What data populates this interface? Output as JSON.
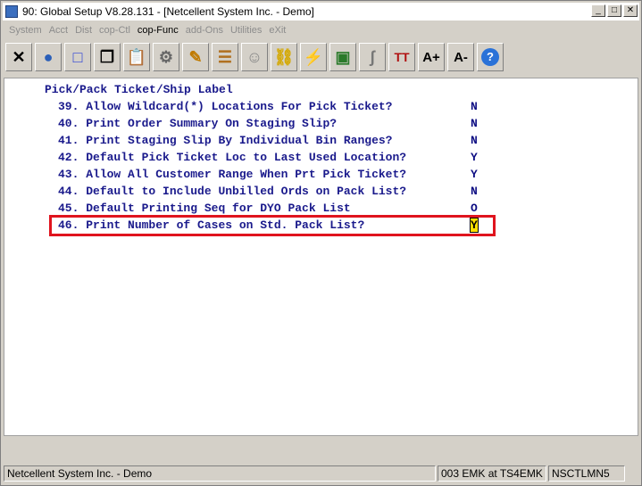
{
  "window": {
    "title": "90: Global Setup V8.28.131 - [Netcellent System Inc. - Demo]"
  },
  "menu": [
    "System",
    "Acct",
    "Dist",
    "cop-Ctl",
    "cop-Func",
    "add-Ons",
    "Utilities",
    "eXit"
  ],
  "toolbar": [
    {
      "name": "close-tool-icon",
      "glyph": "✕"
    },
    {
      "name": "globe-icon",
      "glyph": "●"
    },
    {
      "name": "select-box-icon",
      "glyph": "□"
    },
    {
      "name": "copy-icon",
      "glyph": "❐"
    },
    {
      "name": "paste-icon",
      "glyph": "📋"
    },
    {
      "name": "settings-icon",
      "glyph": "⚙"
    },
    {
      "name": "edit-icon",
      "glyph": "✎"
    },
    {
      "name": "notes-icon",
      "glyph": "☰"
    },
    {
      "name": "users-icon",
      "glyph": "☺"
    },
    {
      "name": "link-icon",
      "glyph": "⛓"
    },
    {
      "name": "lightning-icon",
      "glyph": "⚡"
    },
    {
      "name": "window-flash-icon",
      "glyph": "▣"
    },
    {
      "name": "signature-icon",
      "glyph": "ʃ"
    },
    {
      "name": "font-type-icon",
      "glyph": "TT"
    },
    {
      "name": "increase-font-icon",
      "glyph": "A+"
    },
    {
      "name": "decrease-font-icon",
      "glyph": "A-"
    },
    {
      "name": "help-icon",
      "glyph": "?"
    }
  ],
  "screen": {
    "header": "Pick/Pack Ticket/Ship Label",
    "rows": [
      {
        "num": "39.",
        "label": "Allow Wildcard(*) Locations For Pick Ticket?",
        "value": "N"
      },
      {
        "num": "40.",
        "label": "Print Order Summary On Staging Slip?",
        "value": "N"
      },
      {
        "num": "41.",
        "label": "Print Staging Slip By Individual Bin Ranges?",
        "value": "N"
      },
      {
        "num": "42.",
        "label": "Default Pick Ticket Loc to Last Used Location?",
        "value": "Y"
      },
      {
        "num": "43.",
        "label": "Allow All Customer Range When Prt Pick Ticket?",
        "value": "Y"
      },
      {
        "num": "44.",
        "label": "Default to Include Unbilled Ords on Pack List?",
        "value": "N"
      },
      {
        "num": "45.",
        "label": "Default Printing Seq for DYO Pack List",
        "value": "O"
      },
      {
        "num": "46.",
        "label": "Print Number of Cases on Std. Pack List?",
        "value": "Y"
      }
    ]
  },
  "status": {
    "company": "Netcellent System Inc. - Demo",
    "user": "003 EMK at TS4EMK",
    "server": "NSCTLMN5"
  },
  "colors": {
    "text": "#1a1a8c",
    "highlight_border": "#e0141e",
    "cursor_bg": "#ffe000"
  }
}
